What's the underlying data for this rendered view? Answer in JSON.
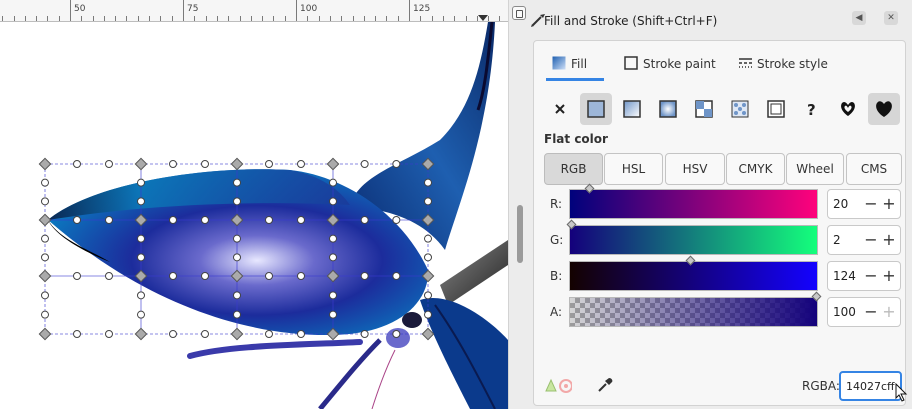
{
  "ruler": {
    "labels": [
      "50",
      "75",
      "100",
      "125"
    ]
  },
  "dialog": {
    "title": "Fill and Stroke (Shift+Ctrl+F)",
    "tabs": [
      "Fill",
      "Stroke paint",
      "Stroke style"
    ],
    "active_tab": "Fill",
    "paint_modes": [
      "no-paint-icon",
      "flat-color-icon",
      "linear-gradient-icon",
      "radial-gradient-icon",
      "pattern-icon",
      "swatch-icon",
      "mesh-icon",
      "unset-paint-icon",
      "fill-rule-evenodd-icon",
      "fill-rule-nonzero-icon"
    ],
    "section_label": "Flat color",
    "color_models": [
      "RGB",
      "HSL",
      "HSV",
      "CMYK",
      "Wheel",
      "CMS"
    ],
    "active_model": "RGB",
    "sliders": [
      {
        "label": "R:",
        "value": "20"
      },
      {
        "label": "G:",
        "value": "2"
      },
      {
        "label": "B:",
        "value": "124"
      },
      {
        "label": "A:",
        "value": "100"
      }
    ],
    "rgba_label": "RGBA:",
    "rgba_value": "14027cff"
  },
  "colors": {
    "accent": "#3584e4",
    "current_color": "#14027c"
  }
}
